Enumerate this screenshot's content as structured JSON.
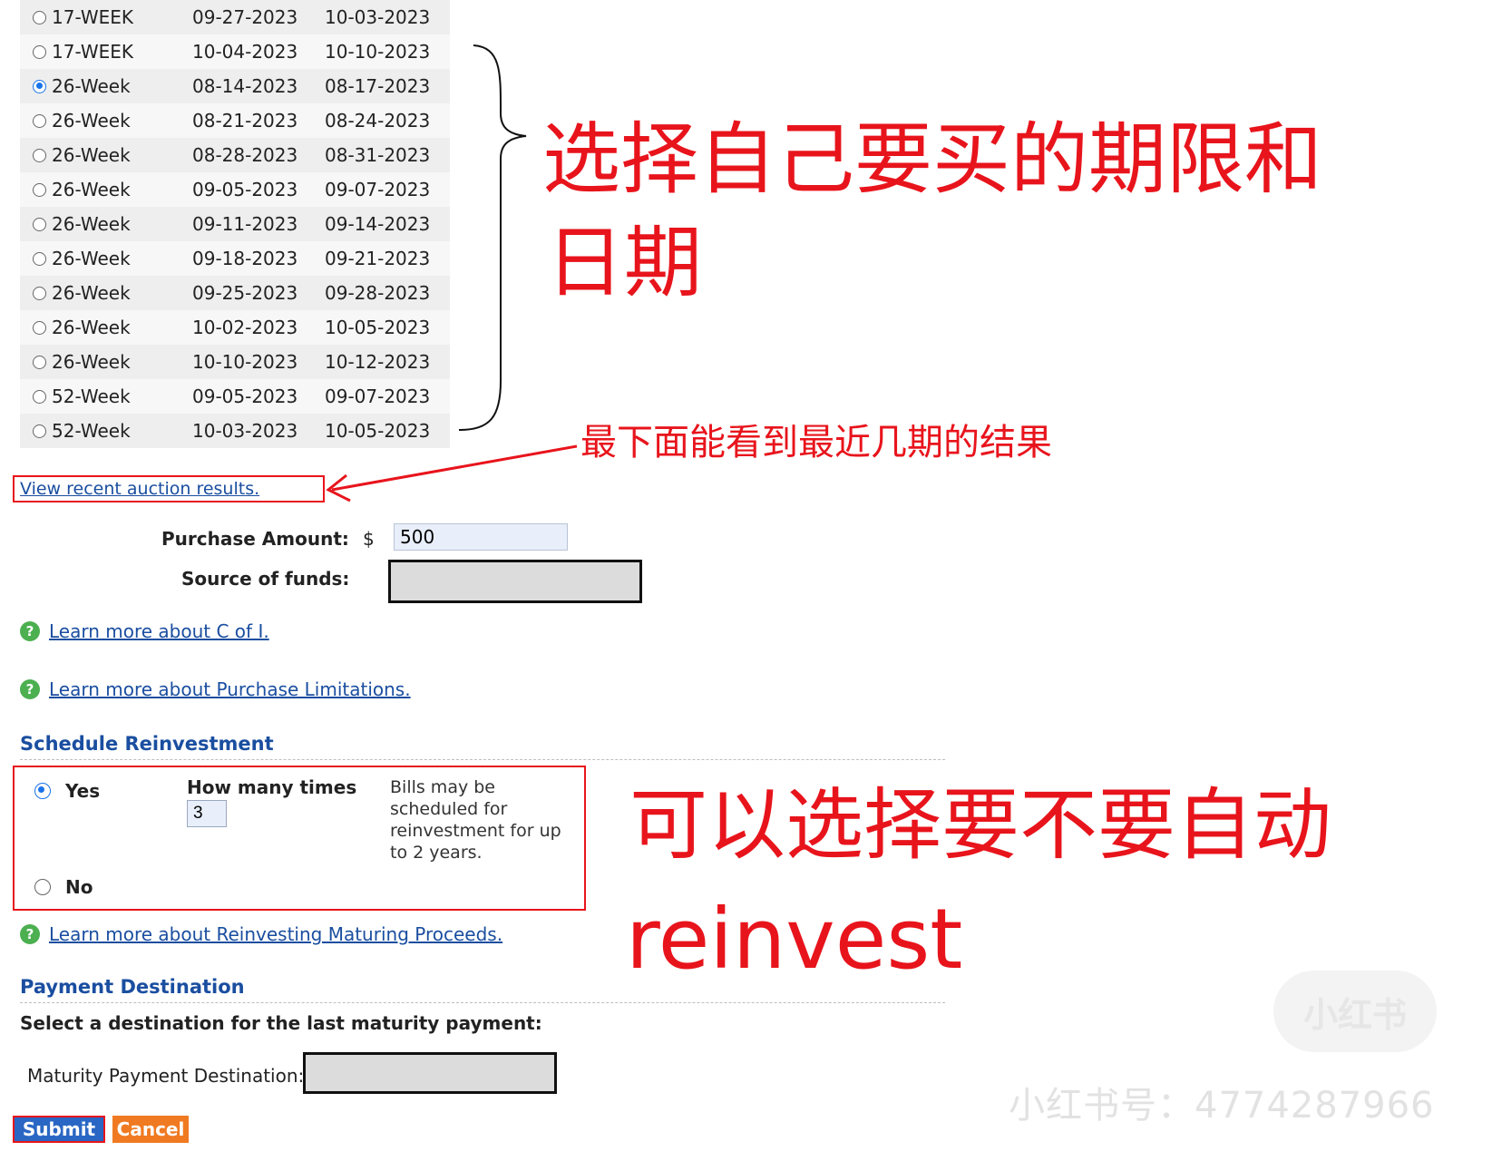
{
  "auction_rows": [
    {
      "term": "17-WEEK",
      "issue": "09-27-2023",
      "maturity": "10-03-2023",
      "selected": false
    },
    {
      "term": "17-WEEK",
      "issue": "10-04-2023",
      "maturity": "10-10-2023",
      "selected": false
    },
    {
      "term": "26-Week",
      "issue": "08-14-2023",
      "maturity": "08-17-2023",
      "selected": true
    },
    {
      "term": "26-Week",
      "issue": "08-21-2023",
      "maturity": "08-24-2023",
      "selected": false
    },
    {
      "term": "26-Week",
      "issue": "08-28-2023",
      "maturity": "08-31-2023",
      "selected": false
    },
    {
      "term": "26-Week",
      "issue": "09-05-2023",
      "maturity": "09-07-2023",
      "selected": false
    },
    {
      "term": "26-Week",
      "issue": "09-11-2023",
      "maturity": "09-14-2023",
      "selected": false
    },
    {
      "term": "26-Week",
      "issue": "09-18-2023",
      "maturity": "09-21-2023",
      "selected": false
    },
    {
      "term": "26-Week",
      "issue": "09-25-2023",
      "maturity": "09-28-2023",
      "selected": false
    },
    {
      "term": "26-Week",
      "issue": "10-02-2023",
      "maturity": "10-05-2023",
      "selected": false
    },
    {
      "term": "26-Week",
      "issue": "10-10-2023",
      "maturity": "10-12-2023",
      "selected": false
    },
    {
      "term": "52-Week",
      "issue": "09-05-2023",
      "maturity": "09-07-2023",
      "selected": false
    },
    {
      "term": "52-Week",
      "issue": "10-03-2023",
      "maturity": "10-05-2023",
      "selected": false
    }
  ],
  "annotations": {
    "choose_term_line1": "选择自己要买的期限和",
    "choose_term_line2": "日期",
    "recent_results": "最下面能看到最近几期的结果",
    "reinvest_line1": "可以选择要不要自动",
    "reinvest_line2": "reinvest"
  },
  "links": {
    "view_results": "View recent auction results.",
    "learn_c_of_i": "Learn more about C of I.",
    "learn_limitations": "Learn more about Purchase Limitations.",
    "learn_reinvesting": "Learn more about Reinvesting Maturing Proceeds."
  },
  "purchase": {
    "amount_label": "Purchase Amount:",
    "currency": "$",
    "amount_value": "500",
    "source_label": "Source of funds:"
  },
  "reinvestment": {
    "title": "Schedule Reinvestment",
    "yes_label": "Yes",
    "no_label": "No",
    "yes_selected": true,
    "times_label": "How many times",
    "times_value": "3",
    "note": "Bills may be scheduled for reinvestment for up to 2 years."
  },
  "payment": {
    "title": "Payment Destination",
    "instruction": "Select a destination for the last maturity payment:",
    "dest_label": "Maturity Payment Destination:"
  },
  "buttons": {
    "submit": "Submit",
    "cancel": "Cancel"
  },
  "watermark": {
    "logo": "小红书",
    "account": "小红书号：4774287966"
  },
  "colors": {
    "annotation_red": "#e8141c",
    "link_blue": "#1a4ea0",
    "submit_blue": "#2a67c4",
    "cancel_orange": "#f07a22",
    "help_green": "#4caf50"
  }
}
